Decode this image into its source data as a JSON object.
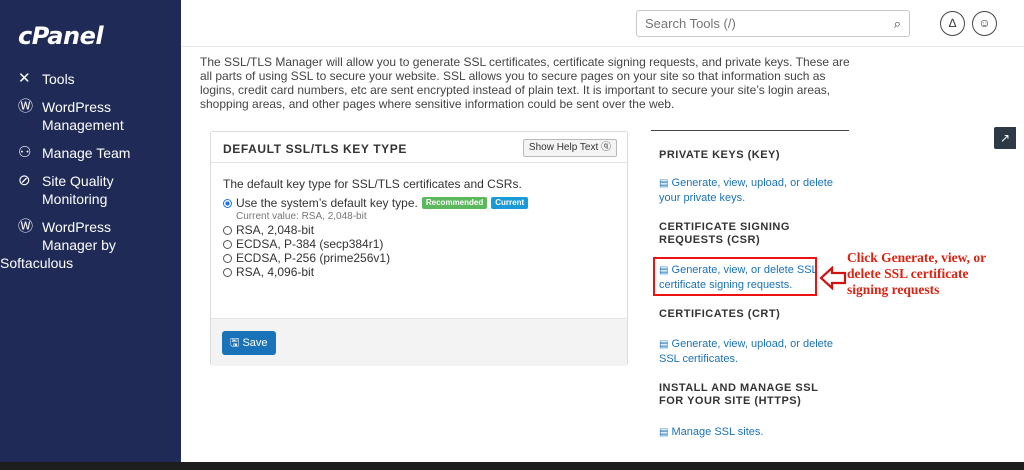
{
  "sidebar": {
    "logo": "cPanel",
    "items": [
      {
        "icon": "tools-icon",
        "glyph": "✕",
        "label": "Tools"
      },
      {
        "icon": "wordpress-icon",
        "glyph": "Ⓦ",
        "label": "WordPress Management"
      },
      {
        "icon": "team-icon",
        "glyph": "⚇",
        "label": "Manage Team"
      },
      {
        "icon": "site-quality-icon",
        "glyph": "⊘",
        "label": "Site Quality Monitoring"
      },
      {
        "icon": "wordpress-softaculous-icon",
        "glyph": "Ⓦ",
        "label_line1": "WordPress",
        "label_line2": "Manager by",
        "label_line3": "Softaculous"
      }
    ]
  },
  "header": {
    "search_placeholder": "Search Tools (/)"
  },
  "intro": "The SSL/TLS Manager will allow you to generate SSL certificates, certificate signing requests, and private keys. These are all parts of using SSL to secure your website. SSL allows you to secure pages on your site so that information such as logins, credit card numbers, etc are sent encrypted instead of plain text. It is important to secure your site’s login areas, shopping areas, and other pages where sensitive information could be sent over the web.",
  "panel": {
    "title": "DEFAULT SSL/TLS KEY TYPE",
    "help_button": "Show Help Text",
    "description": "The default key type for SSL/TLS certificates and CSRs.",
    "option_default": "Use the system’s default key type.",
    "badge_recommended": "Recommended",
    "badge_current": "Current",
    "current_value": "Current value: RSA, 2,048-bit",
    "options": [
      "RSA, 2,048-bit",
      "ECDSA, P-384 (secp384r1)",
      "ECDSA, P-256 (prime256v1)",
      "RSA, 4,096-bit"
    ],
    "save": "Save"
  },
  "right": {
    "private_keys_title": "PRIVATE KEYS (KEY)",
    "private_keys_link_1": "Generate, view, upload, or delete",
    "private_keys_link_2": "your private keys.",
    "csr_title_1": "CERTIFICATE SIGNING",
    "csr_title_2": "REQUESTS (CSR)",
    "csr_link_1": "Generate, view, or delete SSL",
    "csr_link_2": "certificate signing requests.",
    "crt_title": "CERTIFICATES (CRT)",
    "crt_link_1": "Generate, view, upload, or delete",
    "crt_link_2": "SSL certificates.",
    "install_title_1": "INSTALL AND MANAGE SSL",
    "install_title_2": "FOR YOUR SITE (HTTPS)",
    "install_link": "Manage SSL sites."
  },
  "annotation": {
    "line1": "Click Generate, view, or",
    "line2": "delete SSL certificate",
    "line3": "signing requests"
  },
  "colors": {
    "sidebar_bg": "#1f2a57",
    "link": "#1a73b8",
    "annotation_red": "#d21111"
  }
}
